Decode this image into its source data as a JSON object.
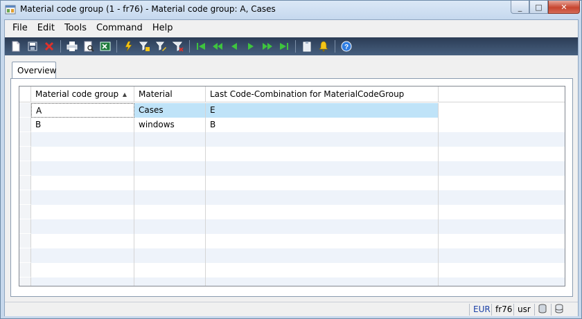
{
  "window": {
    "title": "Material code group (1 - fr76) - Material code group: A, Cases",
    "minimize_label": "_",
    "maximize_label": "□",
    "close_label": "✕"
  },
  "menu": [
    "File",
    "Edit",
    "Tools",
    "Command",
    "Help"
  ],
  "toolbar": {
    "icons": [
      "new-icon",
      "save-icon",
      "delete-icon",
      "print-icon",
      "print-preview-icon",
      "export-excel-icon",
      "filter-by-selection-icon",
      "advanced-filter-icon",
      "filter-by-grid-icon",
      "remove-filter-icon",
      "first-record-icon",
      "previous-page-icon",
      "previous-record-icon",
      "next-record-icon",
      "next-page-icon",
      "last-record-icon",
      "document-handling-icon",
      "alert-icon",
      "help-icon"
    ]
  },
  "tabs": [
    "Overview"
  ],
  "grid": {
    "columns": [
      "Material code group",
      "Material",
      "Last Code-Combination for MaterialCodeGroup"
    ],
    "sort_column": "Material code group",
    "sort_direction": "ascending",
    "rows": [
      [
        "A",
        "Cases",
        "E"
      ],
      [
        "B",
        "windows",
        "B"
      ]
    ],
    "selected_row": 0
  },
  "status": {
    "currency": "EUR",
    "company": "fr76",
    "user": "usr"
  },
  "colors": {
    "toolbar_bg": "#2b3c55",
    "selection": "#bfe3f8",
    "alt_row": "#eef3fa"
  }
}
